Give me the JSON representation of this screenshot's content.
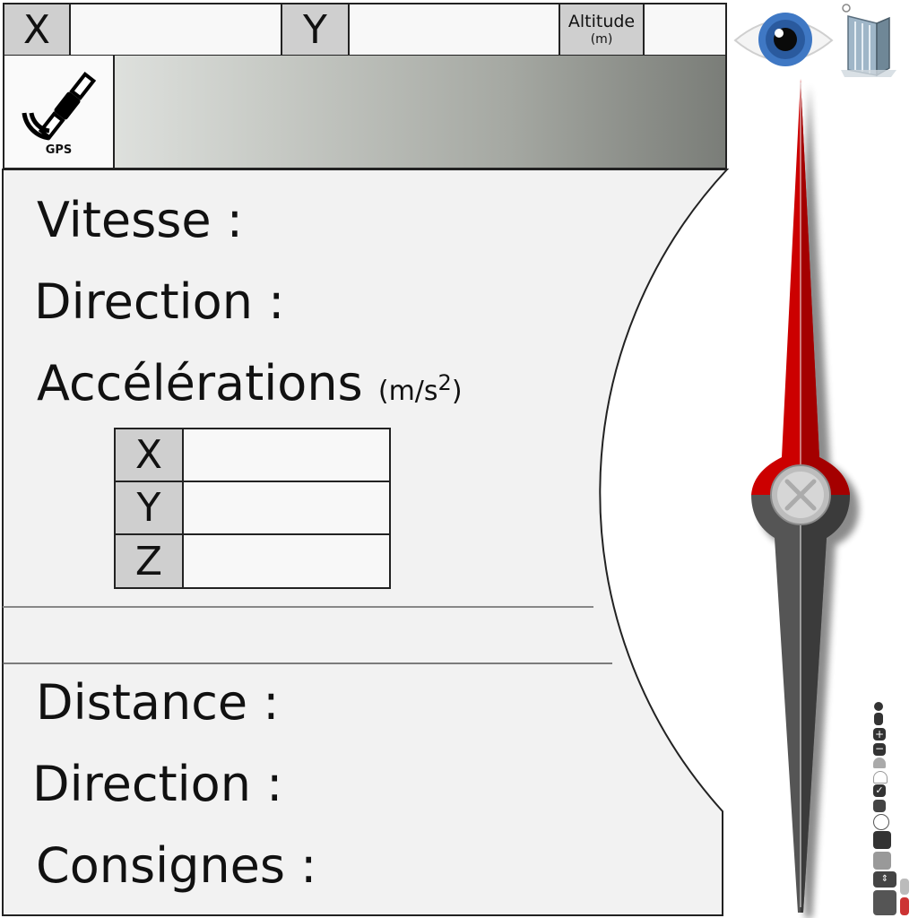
{
  "coords": {
    "x_label": "X",
    "x_value": "",
    "y_label": "Y",
    "y_value": "",
    "altitude_label": "Altitude",
    "altitude_unit": "(m)",
    "altitude_value": ""
  },
  "gps": {
    "icon_label": "GPS"
  },
  "motion": {
    "speed_label": "Vitesse :",
    "direction_label": "Direction :",
    "acceleration_label": "Accélérations",
    "acceleration_unit_base": "(m/s",
    "acceleration_unit_exp": "2",
    "acceleration_unit_close": ")",
    "axes": [
      {
        "label": "X",
        "value": ""
      },
      {
        "label": "Y",
        "value": ""
      },
      {
        "label": "Z",
        "value": ""
      }
    ]
  },
  "navigation": {
    "distance_label": "Distance :",
    "direction_label": "Direction :",
    "instructions_label": "Consignes :"
  },
  "icons": {
    "view": "eye-icon",
    "building": "building-icon",
    "compass": "compass-needle-icon"
  },
  "colors": {
    "needle_north": "#cc0000",
    "needle_south": "#444444",
    "panel_bg": "#f2f2f2",
    "label_cell": "#cfcfcf"
  }
}
